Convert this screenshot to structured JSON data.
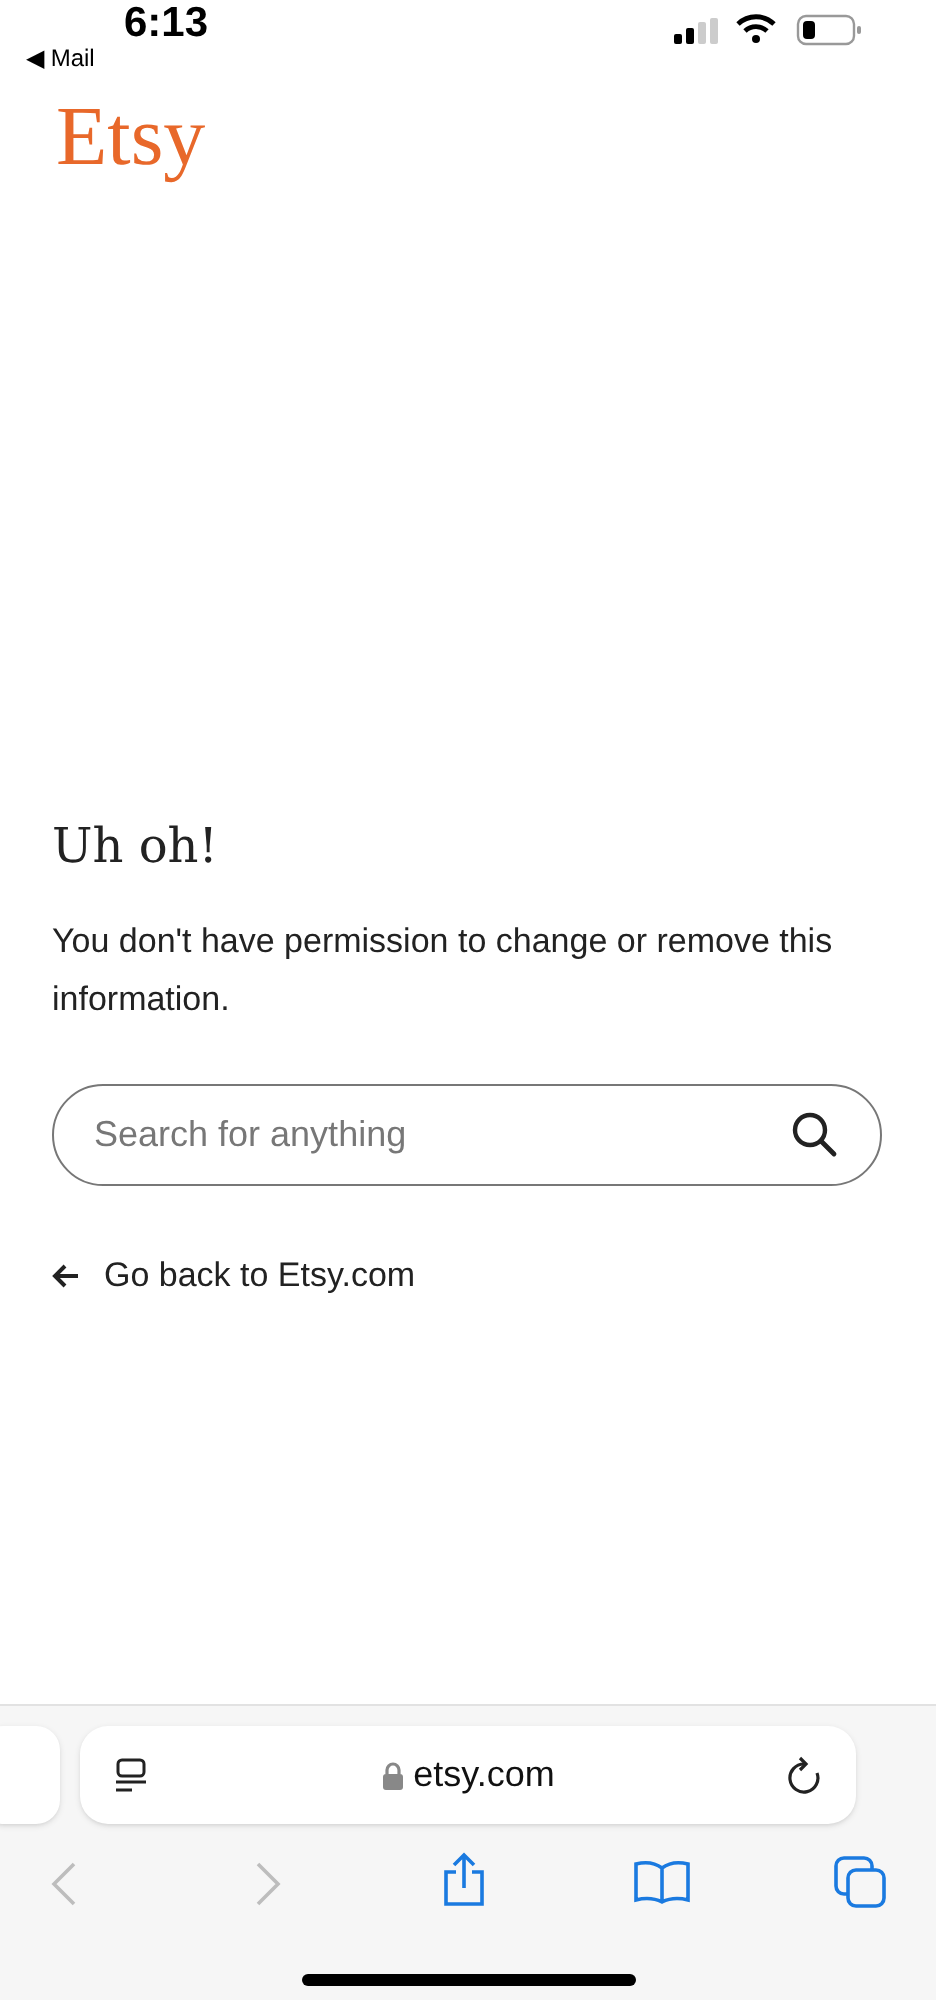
{
  "status_bar": {
    "time": "6:13",
    "back_app": "◀ Mail"
  },
  "logo": "Etsy",
  "error": {
    "heading": "Uh oh!",
    "message": "You don't have permission to change or remove this information."
  },
  "search": {
    "placeholder": "Search for anything"
  },
  "back_link": "Go back to Etsy.com",
  "browser": {
    "address": "etsy.com",
    "back_disabled": true,
    "forward_disabled": true
  }
}
